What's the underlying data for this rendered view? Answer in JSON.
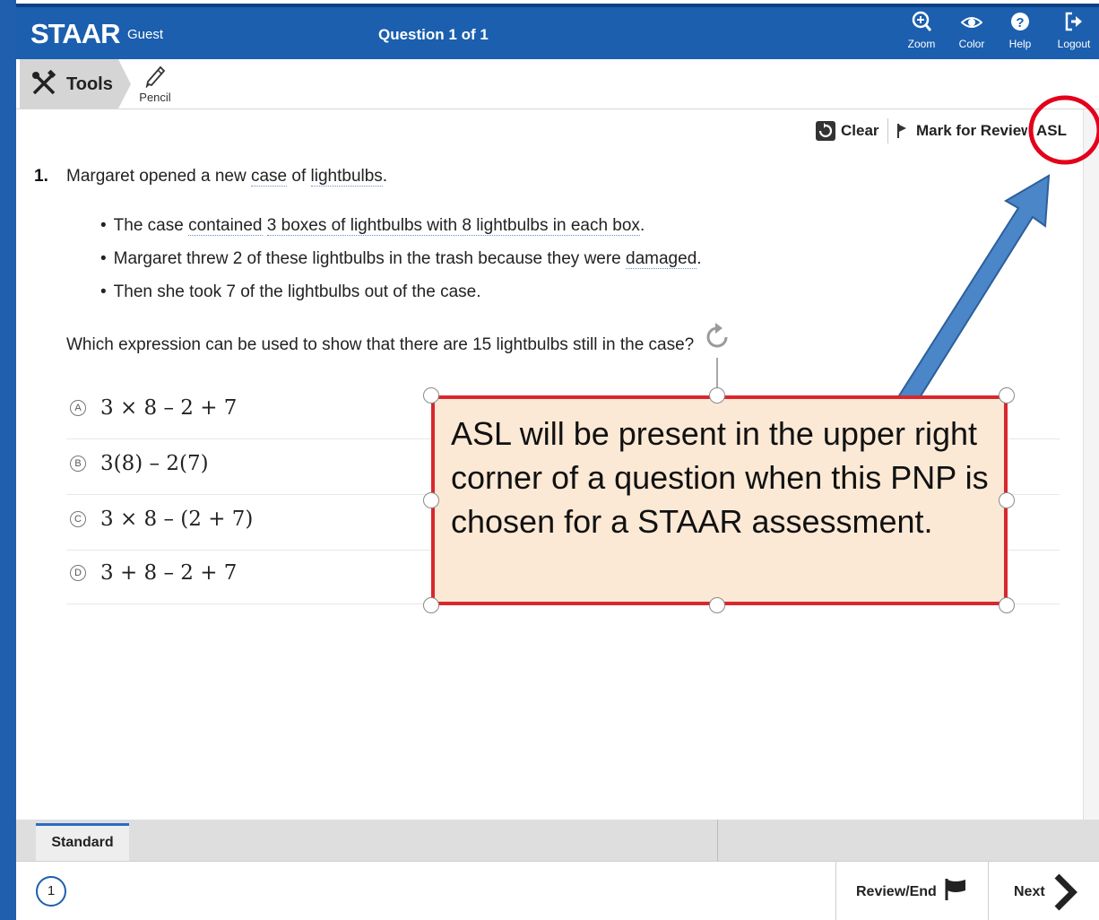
{
  "header": {
    "logo": "STAAR",
    "user": "Guest",
    "question_title": "Question 1 of 1",
    "buttons": [
      {
        "label": "Zoom",
        "icon": "zoom-icon"
      },
      {
        "label": "Color",
        "icon": "eye-icon"
      },
      {
        "label": "Help",
        "icon": "help-icon"
      },
      {
        "label": "Logout",
        "icon": "logout-icon"
      }
    ]
  },
  "toolbar": {
    "tools_label": "Tools",
    "tools_icon": "tools-icon",
    "pencil_label": "Pencil",
    "pencil_icon": "pencil-icon"
  },
  "actions": {
    "clear_label": "Clear",
    "clear_icon": "reset-icon",
    "mark_label": "Mark for Review",
    "mark_icon": "flag-icon",
    "asl_label": "ASL"
  },
  "question": {
    "number": "1.",
    "stem_parts": [
      "Margaret opened a new ",
      "case",
      " of ",
      "lightbulbs",
      "."
    ],
    "bullets": [
      {
        "parts": [
          "The case ",
          "contained",
          " ",
          "3 boxes of lightbulbs with 8 lightbulbs in each box",
          "."
        ]
      },
      {
        "parts": [
          "Margaret threw 2 of these lightbulbs in the trash because they were ",
          "damaged",
          "."
        ]
      },
      {
        "parts": [
          "Then she took 7 of the lightbulbs out of the case."
        ]
      }
    ],
    "prompt": "Which expression can be used to show that there are 15 lightbulbs still in the case?",
    "choices": [
      {
        "letter": "A",
        "expression": "3 × 8 – 2 + 7"
      },
      {
        "letter": "B",
        "expression": "3(8) – 2(7)"
      },
      {
        "letter": "C",
        "expression": "3 × 8 – (2 + 7)"
      },
      {
        "letter": "D",
        "expression": "3 + 8 – 2 + 7"
      }
    ]
  },
  "footer": {
    "tab_label": "Standard",
    "question_index": "1",
    "review_label": "Review/End",
    "next_label": "Next"
  },
  "callout": {
    "text": "ASL will be present in the upper right corner of a question when this PNP is chosen for a STAAR assessment."
  },
  "colors": {
    "header_blue": "#1b5fae",
    "callout_border": "#d9272e",
    "callout_fill": "#fbe9d5",
    "arrow_blue": "#4a86c8",
    "highlight_circle": "#e3001b"
  }
}
